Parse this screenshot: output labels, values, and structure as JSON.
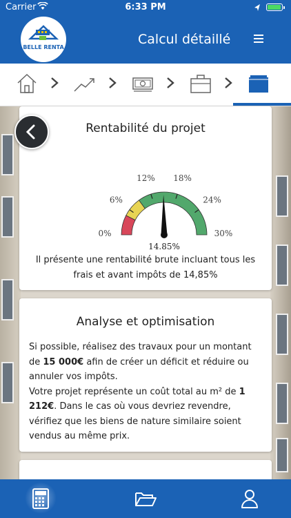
{
  "status": {
    "carrier": "Carrier",
    "time": "6:33 PM"
  },
  "header": {
    "logo_text": "BELLE RENTA",
    "title": "Calcul détaillé"
  },
  "steps": [
    "home-icon",
    "chart-icon",
    "money-icon",
    "briefcase-icon",
    "folder-icon"
  ],
  "card1": {
    "title": "Rentabilité du projet",
    "gauge": {
      "ticks": [
        "0%",
        "6%",
        "12%",
        "18%",
        "24%",
        "30%"
      ],
      "value": 14.85,
      "value_label": "14.85%",
      "min": 0,
      "max": 30,
      "colors": {
        "red": "#d8475a",
        "yellow": "#e8d453",
        "green": "#52a86c"
      }
    },
    "description": "Il présente une rentabilité brute incluant tous les frais et avant impôts de 14,85%"
  },
  "card2": {
    "title": "Analyse et optimisation",
    "p1_before": "Si possible, réalisez des travaux pour un montant de ",
    "p1_amount": "15 000€",
    "p1_after": " afin de créer un déficit et réduire ou annuler vos impôts.",
    "p2_before": "Votre projet représente un coût total au m² de ",
    "p2_amount": "1 212€",
    "p2_after": ". Dans le cas où vous devriez revendre, vérifiez que les biens de nature similaire soient vendus au même prix."
  },
  "tabbar": [
    "calculator-icon",
    "folder-open-icon",
    "user-icon"
  ],
  "colors": {
    "primary": "#1b62b5"
  }
}
